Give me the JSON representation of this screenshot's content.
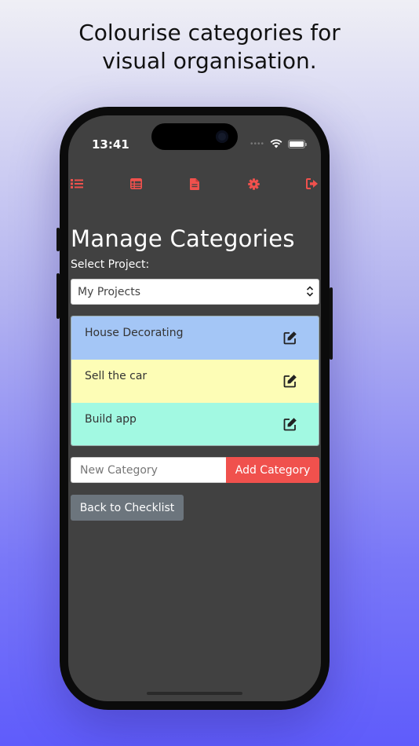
{
  "headline": "Colourise categories for\nvisual organisation.",
  "status": {
    "time": "13:41",
    "signal_icon": "ellipsis-signal-icon",
    "wifi_icon": "wifi-icon",
    "battery_icon": "battery-icon"
  },
  "nav": {
    "accent": "#f0514d",
    "items": [
      {
        "icon": "list-icon"
      },
      {
        "icon": "table-icon"
      },
      {
        "icon": "document-icon"
      },
      {
        "icon": "gear-icon"
      },
      {
        "icon": "sign-out-icon"
      }
    ]
  },
  "page": {
    "title": "Manage Categories",
    "select_label": "Select Project:",
    "selected_project": "My Projects"
  },
  "categories": [
    {
      "name": "House Decorating",
      "color": "#a4c6f6"
    },
    {
      "name": "Sell the car",
      "color": "#fdfdb6"
    },
    {
      "name": "Build app",
      "color": "#a2f9e2"
    }
  ],
  "new_category": {
    "placeholder": "New Category",
    "button_label": "Add Category"
  },
  "back_label": "Back to Checklist"
}
